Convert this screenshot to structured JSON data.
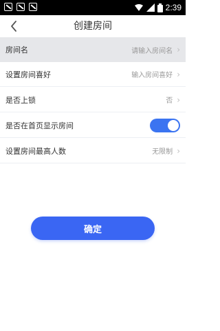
{
  "status_bar": {
    "time": "2:39",
    "notification_icons": [
      "notif-icon",
      "notif-icon",
      "notif-icon"
    ],
    "system_icons": [
      "wifi-icon",
      "signal-icon",
      "battery-icon"
    ]
  },
  "header": {
    "back_icon": "chevron-left-icon",
    "title": "创建房间"
  },
  "form": {
    "room_name": {
      "label": "房间名",
      "placeholder": "请输入房间名"
    },
    "room_hobby": {
      "label": "设置房间喜好",
      "placeholder": "输入房间喜好"
    },
    "lock": {
      "label": "是否上锁",
      "value": "否"
    },
    "show_home": {
      "label": "是否在首页显示房间",
      "toggle_on": true
    },
    "max_people": {
      "label": "设置房间最高人数",
      "value": "无限制"
    }
  },
  "actions": {
    "confirm_label": "确定"
  },
  "colors": {
    "accent": "#3a66f3",
    "toggle": "#3b74f1",
    "first_row_bg": "#e6e7ea"
  }
}
